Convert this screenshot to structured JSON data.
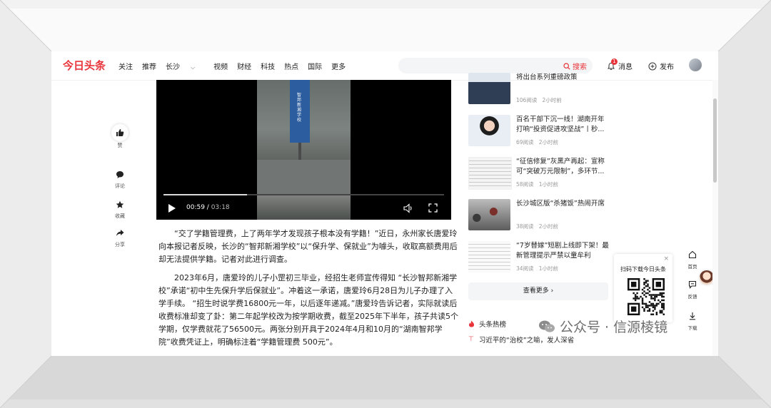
{
  "header": {
    "logo": "今日头条",
    "nav": [
      "关注",
      "推荐",
      "长沙",
      "视频",
      "财经",
      "科技",
      "热点",
      "国际",
      "更多"
    ],
    "search_button": "搜索",
    "messages_label": "消息",
    "messages_badge": "1",
    "publish_label": "发布"
  },
  "rail": {
    "like_label": "赞",
    "comment_label": "评论",
    "favorite_label": "收藏",
    "share_label": "分享"
  },
  "video": {
    "current_time": "00:59",
    "duration": "03:18",
    "progress": 0.298,
    "sign_text": "智邦新湘学校"
  },
  "article": {
    "paragraphs": [
      "“交了学籍管理费，上了两年学才发现孩子根本没有学籍！”近日，永州家长唐爱玲向本报记者反映，长沙的“智邦新湘学校”以“保升学、保就业”为噱头，收取高额费用后却无法提供学籍。记者对此进行调查。",
      "2023年6月，唐爱玲的儿子小罡初三毕业，经招生老师宣传得知 “长沙智邦新湘学校”承诺“初中生先保升学后保就业”。冲着这一承诺，唐爱玲6月28日为儿子办理了入学手续。 “招生时说学费16800元一年，以后逐年递减。”唐爱玲告诉记者，实际就读后收费标准却变了卦：第二年起学校改为按学期收费，截至2025年下半年，孩子共读5个学期，仅学费就花了56500元。两张分别开具于2024年4月和10月的“湖南智邦学院”收费凭证上，明确标注着“学籍管理费 500元”。"
    ]
  },
  "sidebar": {
    "news": [
      {
        "title": "将出台系列重磅政策",
        "reads": "106阅读",
        "time": "2小时前"
      },
      {
        "title": "百名干部下沉一线！湖南开年打响“投资促进攻坚战”丨秒...",
        "reads": "69阅读",
        "time": "2小时前"
      },
      {
        "title": "“征信修复”灰黑产再起：宣称可“突破万元限制”，多环节...",
        "reads": "58阅读",
        "time": "1小时前"
      },
      {
        "title": "长沙城区版“杀猪饭”热闹开席",
        "reads": "38阅读",
        "time": "2小时前"
      },
      {
        "title": "“7岁替嫁”短剧上线即下架！最新管理提示严禁以童牟利",
        "reads": "34阅读",
        "time": "1小时前"
      }
    ],
    "more_button": "查看更多",
    "hot_title": "头条热榜",
    "hot_items": [
      "习近平的“治校”之喻，发人深省"
    ]
  },
  "qr_popup": {
    "title": "扫码下载今日头条",
    "close": "×"
  },
  "tools": {
    "home_label": "首页",
    "feedback_label": "反馈",
    "download_label": "下载"
  },
  "watermark": "公众号 · 信源棱镜",
  "colors": {
    "brand": "#e8343a",
    "text": "#222222",
    "meta": "#999999"
  }
}
